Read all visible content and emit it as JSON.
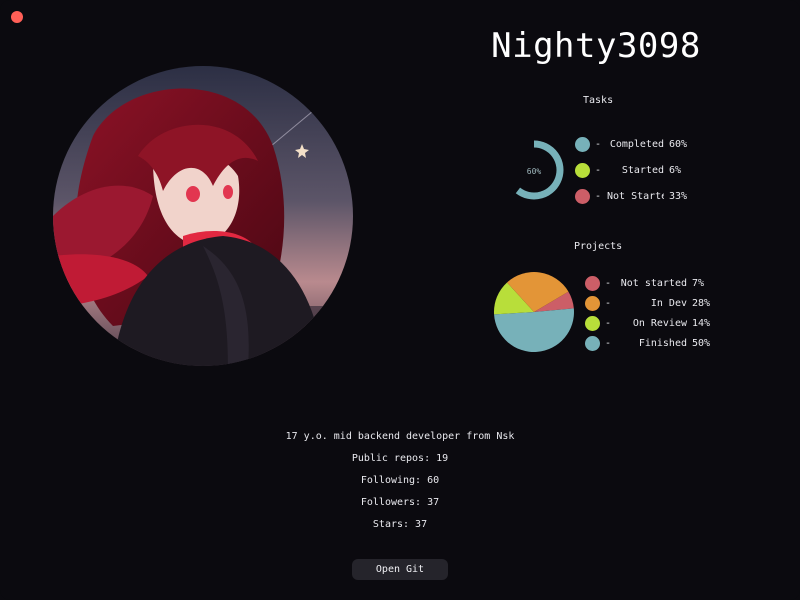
{
  "window": {
    "close_color": "#ff5f57"
  },
  "profile": {
    "username": "Nighty3098",
    "avatar": "anime-girl-red-hair-avatar",
    "bio": "17 y.o. mid backend developer from Nsk",
    "public_repos": "Public repos: 19",
    "following": "Following: 60",
    "followers": "Followers: 37",
    "stars": "Stars: 37"
  },
  "tasks": {
    "title": "Tasks",
    "center_label": "60%",
    "items": [
      {
        "dash": "-",
        "label": "Completed",
        "pct": "60%",
        "color": "#77b1b9"
      },
      {
        "dash": "-",
        "label": "Started",
        "pct": "6%",
        "color": "#b8de3a"
      },
      {
        "dash": "-",
        "label": "Not Started",
        "pct": "33%",
        "color": "#cc5e67"
      }
    ]
  },
  "projects": {
    "title": "Projects",
    "items": [
      {
        "dash": "-",
        "label": "Not started",
        "pct": "7%",
        "color": "#cc5e67"
      },
      {
        "dash": "-",
        "label": "In Dev",
        "pct": "28%",
        "color": "#e39537"
      },
      {
        "dash": "-",
        "label": "On Review",
        "pct": "14%",
        "color": "#b8de3a"
      },
      {
        "dash": "-",
        "label": "Finished",
        "pct": "50%",
        "color": "#77b1b9"
      }
    ]
  },
  "chart_data": [
    {
      "type": "pie",
      "title": "Tasks",
      "categories": [
        "Completed",
        "Started",
        "Not Started"
      ],
      "values": [
        60,
        6,
        33
      ],
      "colors": [
        "#77b1b9",
        "#b8de3a",
        "#cc5e67"
      ]
    },
    {
      "type": "pie",
      "title": "Projects",
      "categories": [
        "Not started",
        "In Dev",
        "On Review",
        "Finished"
      ],
      "values": [
        7,
        28,
        14,
        50
      ],
      "colors": [
        "#cc5e67",
        "#e39537",
        "#b8de3a",
        "#77b1b9"
      ]
    }
  ],
  "actions": {
    "open_git_label": "Open Git"
  }
}
